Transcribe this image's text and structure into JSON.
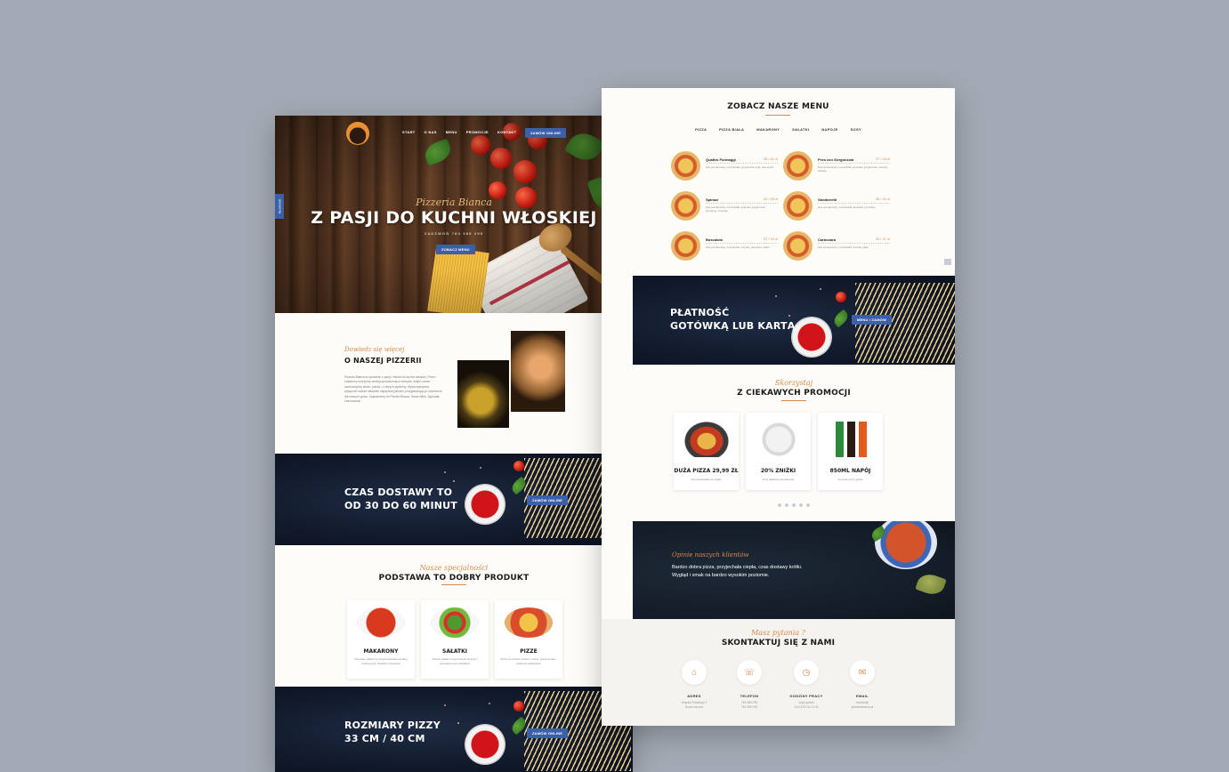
{
  "left_page": {
    "nav": {
      "items": [
        "START",
        "O NAS",
        "MENU",
        "PROMOCJE",
        "KONTAKT"
      ],
      "order_button": "ZAMÓW ONLINE"
    },
    "facebook_tab": "facebook",
    "hero": {
      "script": "Pizzeria Bianca",
      "title": "Z PASJI DO KUCHNI WŁOSKIEJ",
      "phone_line": "ZADZWOŃ 784 985 295",
      "menu_button": "ZOBACZ MENU"
    },
    "about": {
      "script": "Dowiedz się więcej",
      "title": "O NASZEJ PIZZERII",
      "text": "Pizzeria Bianca to opowieść o pasji i miłości do kuchni włoskiej. Pizze i makarony tworzymy według sprawdzonych receptur, dzięki czemu zachowujemy smak i jakość, z których słyniemy. Wykorzystujemy wyłącznie świeże składniki najwyższej jakości, przygotowując je codziennie dla naszych gości. Zapraszamy do Pizzerii Bianca, Nowa Wieś, Zgorzała, Lesznowola."
    },
    "delivery_banner": {
      "line1": "CZAS DOSTAWY TO",
      "line2": "OD 30 DO 60 MINUT",
      "button": "ZAMÓW ONLINE"
    },
    "products": {
      "script": "Nasze specjalności",
      "title": "PODSTAWA TO DOBRY PRODUKT",
      "cards": [
        {
          "title": "MAKARONY",
          "desc": "Domowe makarony przygotowywane według tradycyjnych włoskich przepisów"
        },
        {
          "title": "SAŁATKI",
          "desc": "Świeże sałatki z sezonowych warzyw i aromatycznych dodatków"
        },
        {
          "title": "PIZZE",
          "desc": "Pizza na cienkim cieście z pieca, pełna smaku i świeżych składników"
        }
      ]
    },
    "sizes_banner": {
      "line1": "ROZMIARY PIZZY",
      "line2": "33 CM / 40 CM",
      "button": "ZAMÓW ONLINE"
    }
  },
  "right_page": {
    "menu": {
      "title": "ZOBACZ NASZE MENU",
      "tabs": [
        "PIZZA",
        "PIZZA BIAŁA",
        "MAKARONY",
        "SAŁATKI",
        "NAPOJE",
        "SOSY"
      ],
      "items": [
        {
          "name": "Quattro Formaggi",
          "price": "35 / 41 zł",
          "desc": "Sos pomidorowy, mozzarella, gorgonzola, feta, parmezan"
        },
        {
          "name": "Pera con Gorgonzola",
          "price": "37 / 43 zł",
          "desc": "Sos śmietanowy, mozzarella, gruszka, gorgonzola, orzechy włoskie"
        },
        {
          "name": "Spinaci",
          "price": "32 / 39 zł",
          "desc": "Sos pomidorowy, mozzarella, szpinak, gorgonzola, pomidory, czosnek"
        },
        {
          "name": "Gamberetti",
          "price": "36 / 42 zł",
          "desc": "Sos pomidorowy, mozzarella, krewetki, pomidory"
        },
        {
          "name": "Boscaiola",
          "price": "37 / 43 zł",
          "desc": "Sos pomidorowy, mozzarella, szynka, pieczarki, oliwki"
        },
        {
          "name": "Carbonara",
          "price": "32 / 37 zł",
          "desc": "Sos śmietanowy, mozzarella, boczek, jajko"
        }
      ]
    },
    "payment_banner": {
      "line1": "PŁATNOŚĆ",
      "line2": "GOTÓWKĄ LUB KARTĄ",
      "button": "MENU / ZAMÓW"
    },
    "promotions": {
      "script": "Skorzystaj",
      "title": "Z CIEKAWYCH PROMOCJI",
      "cards": [
        {
          "title": "DUŻA PIZZA 29,99 ZŁ",
          "desc": "Od poniedziałku do piątku"
        },
        {
          "title": "20% ZNIŻKI",
          "desc": "Przy odbiorze zamówienia"
        },
        {
          "title": "850ML NAPÓJ",
          "desc": "Do dużej pizzy gratis"
        }
      ]
    },
    "testimonial": {
      "script": "Opinie naszych klientów",
      "line1": "Bardzo dobra pizza, przyjechała ciepła, czas dostawy krótki.",
      "line2": "Wygląd i smak na bardzo wysokim poziomie."
    },
    "contact": {
      "script": "Masz pytania ?",
      "title": "SKONTAKTUJ SIĘ Z NAMI",
      "items": [
        {
          "label": "ADRES",
          "line1": "Wojska Polskiego 2",
          "line2": "Nowa Iwiczna"
        },
        {
          "label": "TELEFON",
          "line1": "784 985 295",
          "line2": "784 985 295"
        },
        {
          "label": "GODZINY PRACY",
          "line1": "Cały tydzień",
          "line2": "Od 12:00 do 21:30"
        },
        {
          "label": "EMAIL",
          "line1": "kontakt@",
          "line2": "pizzeriabianca.pl"
        }
      ]
    }
  }
}
